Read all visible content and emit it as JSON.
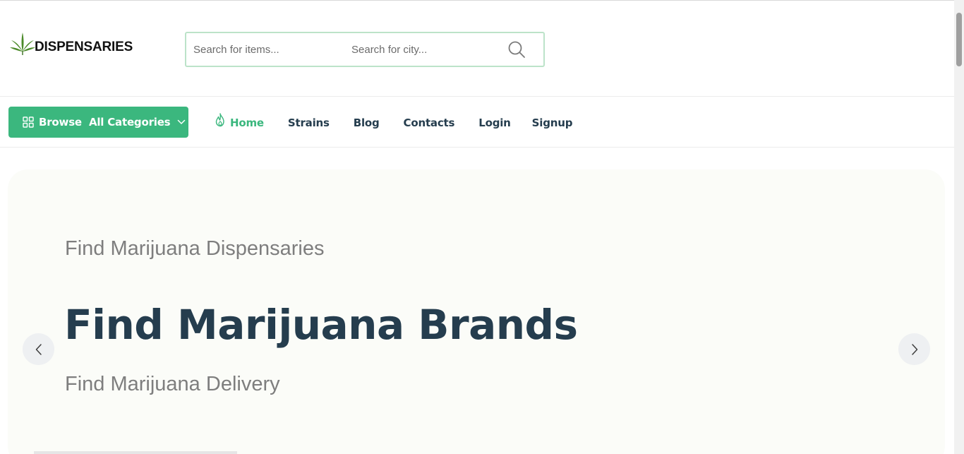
{
  "header": {
    "logo_text": "DISPENSARIES",
    "search": {
      "items_placeholder": "Search for items...",
      "city_placeholder": "Search for city..."
    }
  },
  "nav": {
    "browse_label": "Browse  All Categories",
    "items": [
      {
        "label": "Home",
        "active": true
      },
      {
        "label": "Strains"
      },
      {
        "label": "Blog"
      },
      {
        "label": "Contacts"
      },
      {
        "label": "Login"
      },
      {
        "label": "Signup"
      }
    ]
  },
  "hero": {
    "subtitle_top": "Find Marijuana Dispensaries",
    "title": "Find Marijuana Brands",
    "subtitle_bottom": "Find Marijuana Delivery"
  },
  "colors": {
    "accent": "#3bb77e",
    "heading": "#253d4e",
    "muted": "#7e7e7e",
    "hero_bg": "#fbfcf8",
    "search_border": "#bce3c9"
  },
  "icons": {
    "logo": "cannabis-leaf-icon",
    "search": "search-icon",
    "browse": "grid-icon",
    "browse_caret": "chevron-down-icon",
    "home": "flame-icon",
    "prev": "chevron-left-icon",
    "next": "chevron-right-icon"
  }
}
